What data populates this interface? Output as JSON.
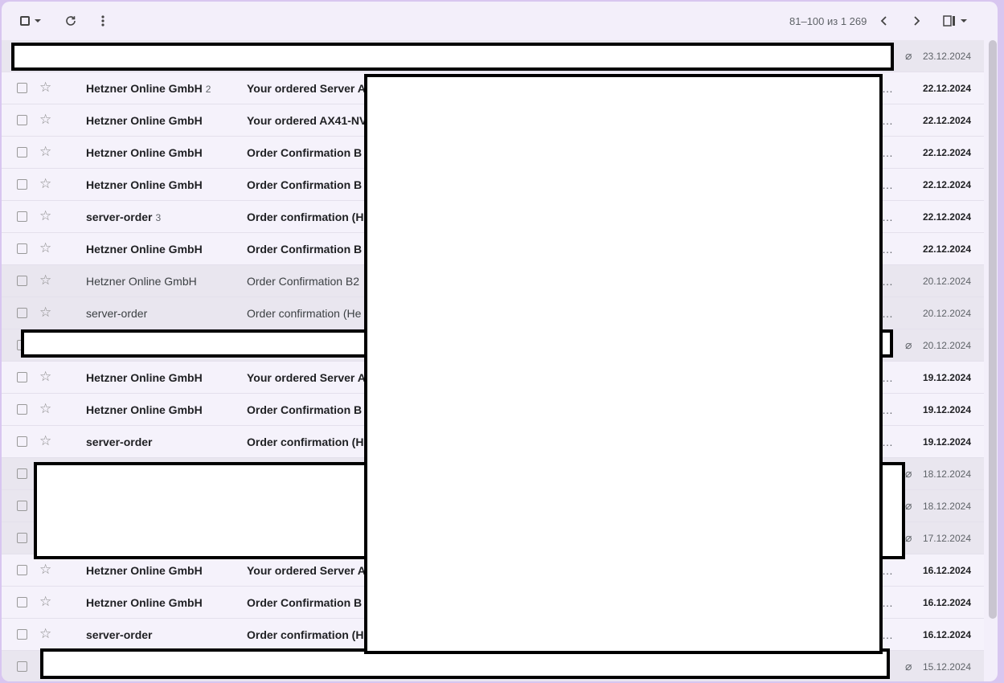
{
  "toolbar": {
    "pagination": "81–100 из 1 269",
    "icons": [
      "select-all-checkbox",
      "select-dropdown-caret",
      "refresh-icon",
      "more-options-icon",
      "newer-page-icon",
      "older-page-icon",
      "split-pane-icon"
    ]
  },
  "rows": [
    {
      "sender": "",
      "count": "",
      "subject": "",
      "date": "23.12.2024",
      "read": true,
      "attachment": true
    },
    {
      "sender": "Hetzner Online GmbH",
      "count": "2",
      "subject": "Your ordered Server A",
      "date": "22.12.2024",
      "read": false
    },
    {
      "sender": "Hetzner Online GmbH",
      "count": "",
      "subject": "Your ordered AX41-NV",
      "date": "22.12.2024",
      "read": false
    },
    {
      "sender": "Hetzner Online GmbH",
      "count": "",
      "subject": "Order Confirmation B",
      "date": "22.12.2024",
      "read": false
    },
    {
      "sender": "Hetzner Online GmbH",
      "count": "",
      "subject": "Order Confirmation B",
      "date": "22.12.2024",
      "read": false
    },
    {
      "sender": "server-order",
      "count": "3",
      "subject": "Order confirmation (H",
      "date": "22.12.2024",
      "read": false
    },
    {
      "sender": "Hetzner Online GmbH",
      "count": "",
      "subject": "Order Confirmation B",
      "date": "22.12.2024",
      "read": false
    },
    {
      "sender": "Hetzner Online GmbH",
      "count": "",
      "subject": "Order Confirmation B2",
      "date": "20.12.2024",
      "read": true
    },
    {
      "sender": "server-order",
      "count": "",
      "subject": "Order confirmation (He",
      "date": "20.12.2024",
      "read": true
    },
    {
      "sender": "",
      "count": "",
      "subject": "",
      "date": "20.12.2024",
      "read": true,
      "attachment": true
    },
    {
      "sender": "Hetzner Online GmbH",
      "count": "",
      "subject": "Your ordered Server A",
      "date": "19.12.2024",
      "read": false
    },
    {
      "sender": "Hetzner Online GmbH",
      "count": "",
      "subject": "Order Confirmation B",
      "date": "19.12.2024",
      "read": false
    },
    {
      "sender": "server-order",
      "count": "",
      "subject": "Order confirmation (H",
      "date": "19.12.2024",
      "read": false
    },
    {
      "sender": "",
      "count": "",
      "subject": "",
      "date": "18.12.2024",
      "read": true,
      "attachment": true
    },
    {
      "sender": "",
      "count": "",
      "subject": "",
      "date": "18.12.2024",
      "read": true,
      "attachment": true
    },
    {
      "sender": "",
      "count": "",
      "subject": "",
      "date": "17.12.2024",
      "read": true,
      "attachment": true
    },
    {
      "sender": "Hetzner Online GmbH",
      "count": "",
      "subject": "Your ordered Server A",
      "date": "16.12.2024",
      "read": false
    },
    {
      "sender": "Hetzner Online GmbH",
      "count": "",
      "subject": "Order Confirmation B",
      "date": "16.12.2024",
      "read": false
    },
    {
      "sender": "server-order",
      "count": "",
      "subject": "Order confirmation (H",
      "date": "16.12.2024",
      "read": false
    },
    {
      "sender": "",
      "count": "",
      "subject": "",
      "date": "15.12.2024",
      "read": true,
      "attachment": true
    }
  ],
  "ellipsis": "…"
}
